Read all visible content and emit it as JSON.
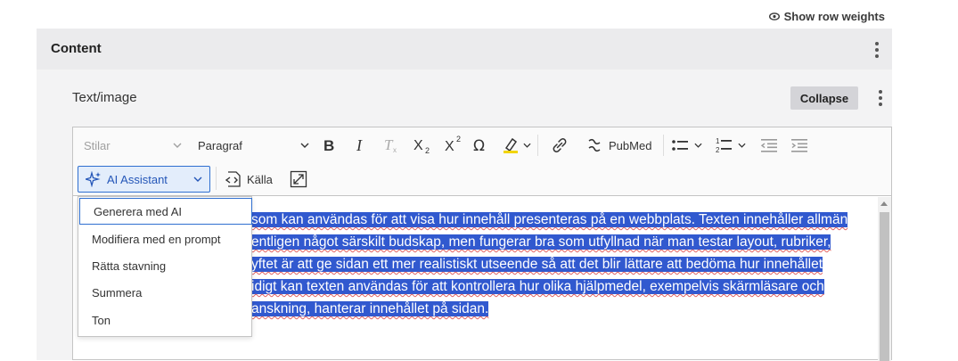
{
  "header": {
    "row_weights_label": "Show row weights"
  },
  "content_panel": {
    "title": "Content"
  },
  "paragraph": {
    "title": "Text/image",
    "collapse_label": "Collapse"
  },
  "toolbar": {
    "styles_placeholder": "Stilar",
    "heading_value": "Paragraf",
    "pubmed_label": "PubMed",
    "ai_label": "AI Assistant",
    "source_label": "Källa"
  },
  "editor": {
    "lines": [
      "som kan användas för att visa hur innehåll presenteras på en webbplats. Texten innehåller allmän",
      "entligen något särskilt budskap, men fungerar bra som utfyllnad när man testar layout, rubriker,",
      "yftet är att ge sidan ett mer realistiskt utseende så att det blir lättare att bedöma hur innehållet",
      "idigt kan texten användas för att kontrollera hur olika hjälpmedel, exempelvis skärmläsare och",
      "anskning, hanterar innehållet på sidan."
    ]
  },
  "ai_menu": {
    "items": [
      "Generera med AI",
      "Modifiera med en prompt",
      "Rätta stavning",
      "Summera",
      "Ton"
    ]
  },
  "colors": {
    "accent": "#2f6fd0",
    "selection": "#3159cf",
    "panel": "#f3f3f4"
  }
}
